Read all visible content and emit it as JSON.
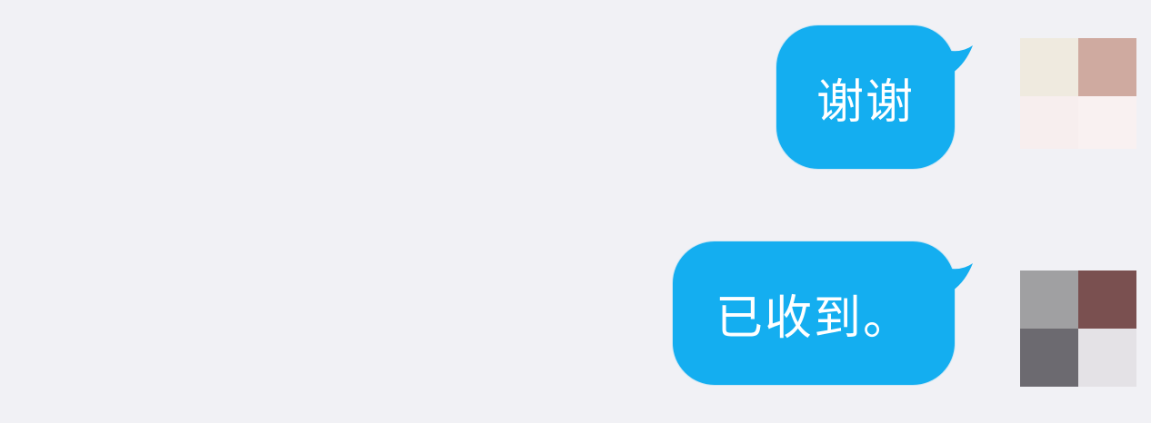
{
  "conversation": {
    "messages": [
      {
        "text": "谢谢",
        "sender": "me"
      },
      {
        "text": "已收到。",
        "sender": "me"
      }
    ],
    "colors": {
      "background": "#f1f1f5",
      "bubble": "#14aef0",
      "bubble_text": "#ffffff"
    }
  },
  "avatars": {
    "first": {
      "icon": "pixelated-avatar-icon"
    },
    "second": {
      "icon": "pixelated-avatar-icon"
    }
  }
}
